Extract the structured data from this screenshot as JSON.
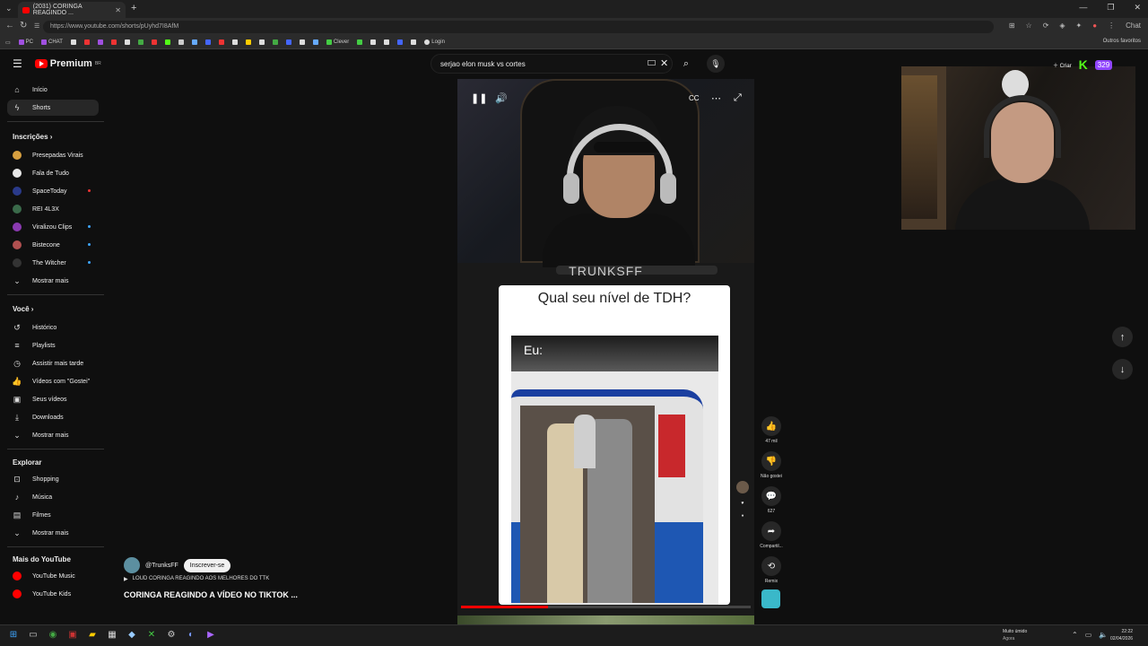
{
  "browser": {
    "tab_title": "(2031) CORINGA REAGINDO ...",
    "url": "https://www.youtube.com/shorts/pUyhd7I8AfM",
    "bookmarks": [
      "PC",
      "CHAT",
      "Clever",
      "Login"
    ],
    "other_bookmarks": "Outros favoritos",
    "chat_label": "Chat"
  },
  "header": {
    "logo": "Premium",
    "logo_sup": "BR",
    "search_value": "serjao elon musk vs cortes"
  },
  "sidebar": {
    "main": [
      {
        "label": "Início",
        "icon": "home-icon"
      },
      {
        "label": "Shorts",
        "icon": "shorts-icon"
      }
    ],
    "subs_heading": "Inscrições",
    "subs": [
      {
        "label": "Presepadas Virais",
        "color": "#d8a040"
      },
      {
        "label": "Fala de Tudo",
        "color": "#e8e8e8"
      },
      {
        "label": "SpaceToday",
        "color": "#2a3a8a"
      },
      {
        "label": "REI 4L3X",
        "color": "#3a6a4a"
      },
      {
        "label": "Viralizou Clips",
        "color": "#8a3ab0"
      },
      {
        "label": "Bistecone",
        "color": "#b05050"
      },
      {
        "label": "The Witcher",
        "color": "#333"
      }
    ],
    "show_more": "Mostrar mais",
    "you_heading": "Você",
    "you": [
      {
        "label": "Histórico",
        "icon": "history-icon"
      },
      {
        "label": "Playlists",
        "icon": "playlist-icon"
      },
      {
        "label": "Assistir mais tarde",
        "icon": "clock-icon"
      },
      {
        "label": "Vídeos com \"Gostei\"",
        "icon": "like-icon"
      },
      {
        "label": "Seus vídeos",
        "icon": "video-icon"
      },
      {
        "label": "Downloads",
        "icon": "download-icon"
      },
      {
        "label": "Mostrar mais",
        "icon": "chevron-down-icon"
      }
    ],
    "explore_heading": "Explorar",
    "explore": [
      {
        "label": "Shopping",
        "icon": "bag-icon"
      },
      {
        "label": "Música",
        "icon": "music-icon"
      },
      {
        "label": "Filmes",
        "icon": "film-icon"
      },
      {
        "label": "Mostrar mais",
        "icon": "chevron-down-icon"
      }
    ],
    "more_heading": "Mais do YouTube",
    "more": [
      {
        "label": "YouTube Music"
      },
      {
        "label": "YouTube Kids"
      }
    ]
  },
  "short": {
    "overlay_name": "TRUNKSFF",
    "card_title": "Qual seu nível de TDH?",
    "card_caption": "Eu:",
    "channel": "@TrunksFF",
    "subscribe": "Inscrever-se",
    "music": "LOUD CORINGA REAGINDO AOS MELHORES DO TTK",
    "title": "CORINGA REAGINDO A VÍDEO NO TIKTOK",
    "title_more": "...",
    "progress": 0.3,
    "actions": {
      "likes": "47 mil",
      "dislike": "Não gostei",
      "comments": "627",
      "share": "Compartil...",
      "remix": "Remix"
    }
  },
  "overlay": {
    "create": "Criar",
    "viewers": "329"
  },
  "taskbar": {
    "weather_title": "Muito úmido",
    "weather_sub": "Agora",
    "time": "22:22",
    "date": "02/04/2026"
  }
}
